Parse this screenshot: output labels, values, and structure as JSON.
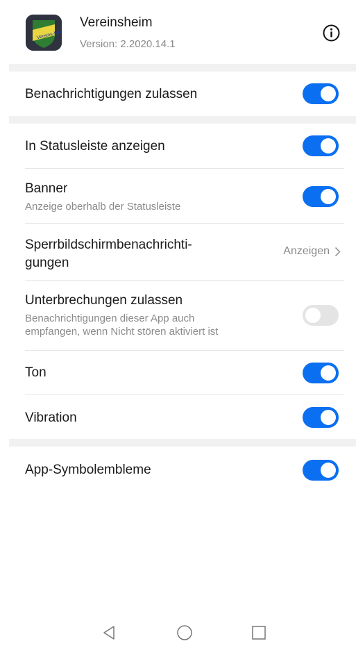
{
  "app": {
    "name": "Vereinsheim",
    "version": "Version: 2.2020.14.1",
    "icon_text": "Vereins-heim",
    "icon": "app-logo-icon"
  },
  "info_icon": "info-icon",
  "settings": {
    "allow_notifications": {
      "title": "Benachrichtigungen zulassen",
      "enabled": true
    },
    "show_in_statusbar": {
      "title": "In Statusleiste anzeigen",
      "enabled": true
    },
    "banner": {
      "title": "Banner",
      "subtitle": "Anzeige oberhalb der Statusleiste",
      "enabled": true
    },
    "lockscreen": {
      "title_line1": "Sperrbildschirmbenachrichti-",
      "title_line2": "gungen",
      "value": "Anzeigen"
    },
    "interruptions": {
      "title": "Unterbrechungen zulassen",
      "subtitle_line1": "Benachrichtigungen dieser App auch",
      "subtitle_line2": "empfangen, wenn Nicht stören aktiviert ist",
      "enabled": false
    },
    "sound": {
      "title": "Ton",
      "enabled": true
    },
    "vibration": {
      "title": "Vibration",
      "enabled": true
    },
    "badges": {
      "title": "App-Symbolembleme",
      "enabled": true
    }
  },
  "navbar": {
    "back": "back-triangle-icon",
    "home": "home-circle-icon",
    "recents": "recents-square-icon"
  },
  "colors": {
    "accent": "#0a6ff0",
    "toggle_off": "#e4e4e4",
    "section_gap": "#f1f1f1",
    "secondary_text": "#8a8a8a"
  }
}
